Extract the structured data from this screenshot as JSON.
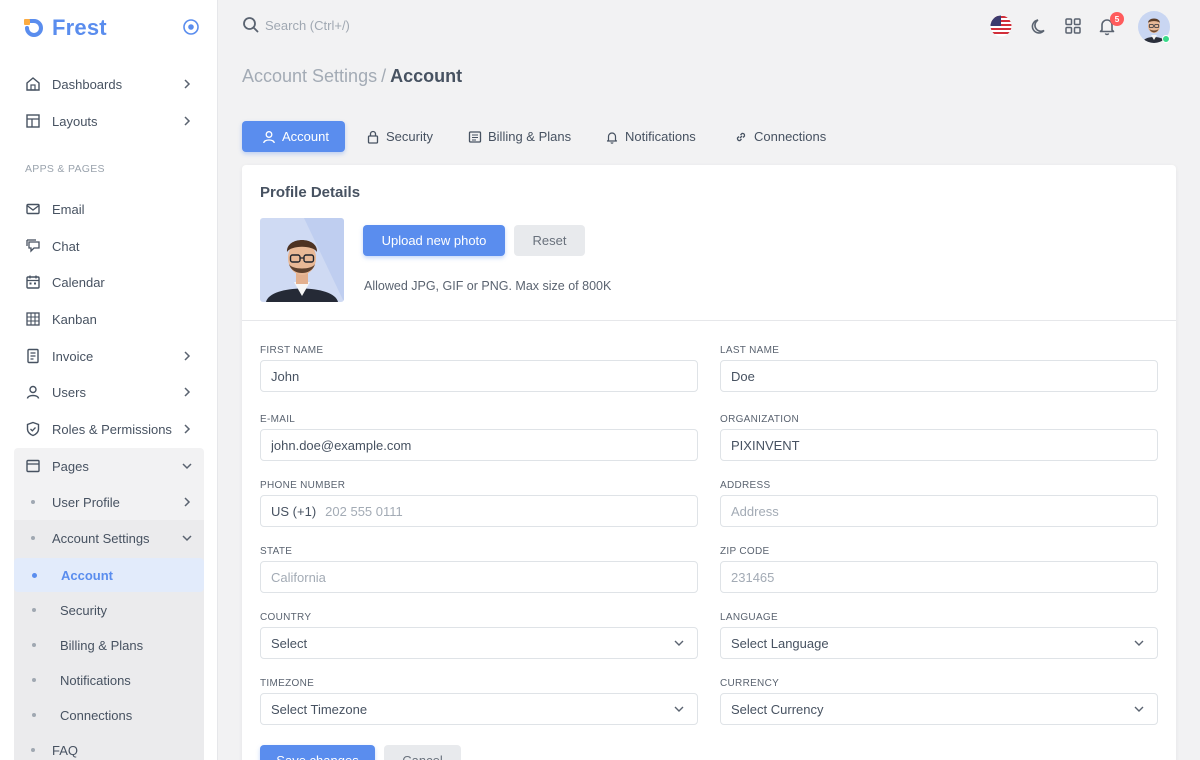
{
  "brand": {
    "name": "Frest",
    "accent": "#5a8dee"
  },
  "sidebar": {
    "section_header": "APPS & PAGES",
    "items": [
      {
        "label": "Dashboards",
        "icon": "home-icon"
      },
      {
        "label": "Layouts",
        "icon": "layout-icon"
      },
      {
        "label": "Email",
        "icon": "mail-icon"
      },
      {
        "label": "Chat",
        "icon": "chat-icon"
      },
      {
        "label": "Calendar",
        "icon": "calendar-icon"
      },
      {
        "label": "Kanban",
        "icon": "grid-icon"
      },
      {
        "label": "Invoice",
        "icon": "file-icon"
      },
      {
        "label": "Users",
        "icon": "user-icon"
      },
      {
        "label": "Roles & Permissions",
        "icon": "shield-icon"
      },
      {
        "label": "Pages",
        "icon": "browser-icon"
      }
    ],
    "pages_sub": [
      {
        "label": "User Profile"
      },
      {
        "label": "Account Settings"
      }
    ],
    "account_sub": [
      {
        "label": "Account"
      },
      {
        "label": "Security"
      },
      {
        "label": "Billing & Plans"
      },
      {
        "label": "Notifications"
      },
      {
        "label": "Connections"
      }
    ],
    "faq": "FAQ"
  },
  "topbar": {
    "search_placeholder": "Search (Ctrl+/)",
    "notification_count": "5"
  },
  "breadcrumb": {
    "parent": "Account Settings",
    "separator": "/",
    "current": "Account"
  },
  "tabs": [
    {
      "label": "Account",
      "icon": "user-icon"
    },
    {
      "label": "Security",
      "icon": "lock-icon"
    },
    {
      "label": "Billing & Plans",
      "icon": "document-icon"
    },
    {
      "label": "Notifications",
      "icon": "bell-icon"
    },
    {
      "label": "Connections",
      "icon": "link-icon"
    }
  ],
  "profile": {
    "title": "Profile Details",
    "upload_label": "Upload new photo",
    "reset_label": "Reset",
    "help_text": "Allowed JPG, GIF or PNG. Max size of 800K"
  },
  "form": {
    "first_name": {
      "label": "FIRST NAME",
      "value": "John"
    },
    "last_name": {
      "label": "LAST NAME",
      "value": "Doe"
    },
    "email": {
      "label": "E-MAIL",
      "value": "john.doe@example.com"
    },
    "organization": {
      "label": "ORGANIZATION",
      "value": "PIXINVENT"
    },
    "phone": {
      "label": "PHONE NUMBER",
      "prefix": "US (+1)",
      "placeholder": "202 555 0111"
    },
    "address": {
      "label": "ADDRESS",
      "placeholder": "Address"
    },
    "state": {
      "label": "STATE",
      "placeholder": "California"
    },
    "zip": {
      "label": "ZIP CODE",
      "placeholder": "231465"
    },
    "country": {
      "label": "COUNTRY",
      "value": "Select"
    },
    "language": {
      "label": "LANGUAGE",
      "value": "Select Language"
    },
    "timezone": {
      "label": "TIMEZONE",
      "value": "Select Timezone"
    },
    "currency": {
      "label": "CURRENCY",
      "value": "Select Currency"
    },
    "save_label": "Save changes",
    "cancel_label": "Cancel"
  }
}
